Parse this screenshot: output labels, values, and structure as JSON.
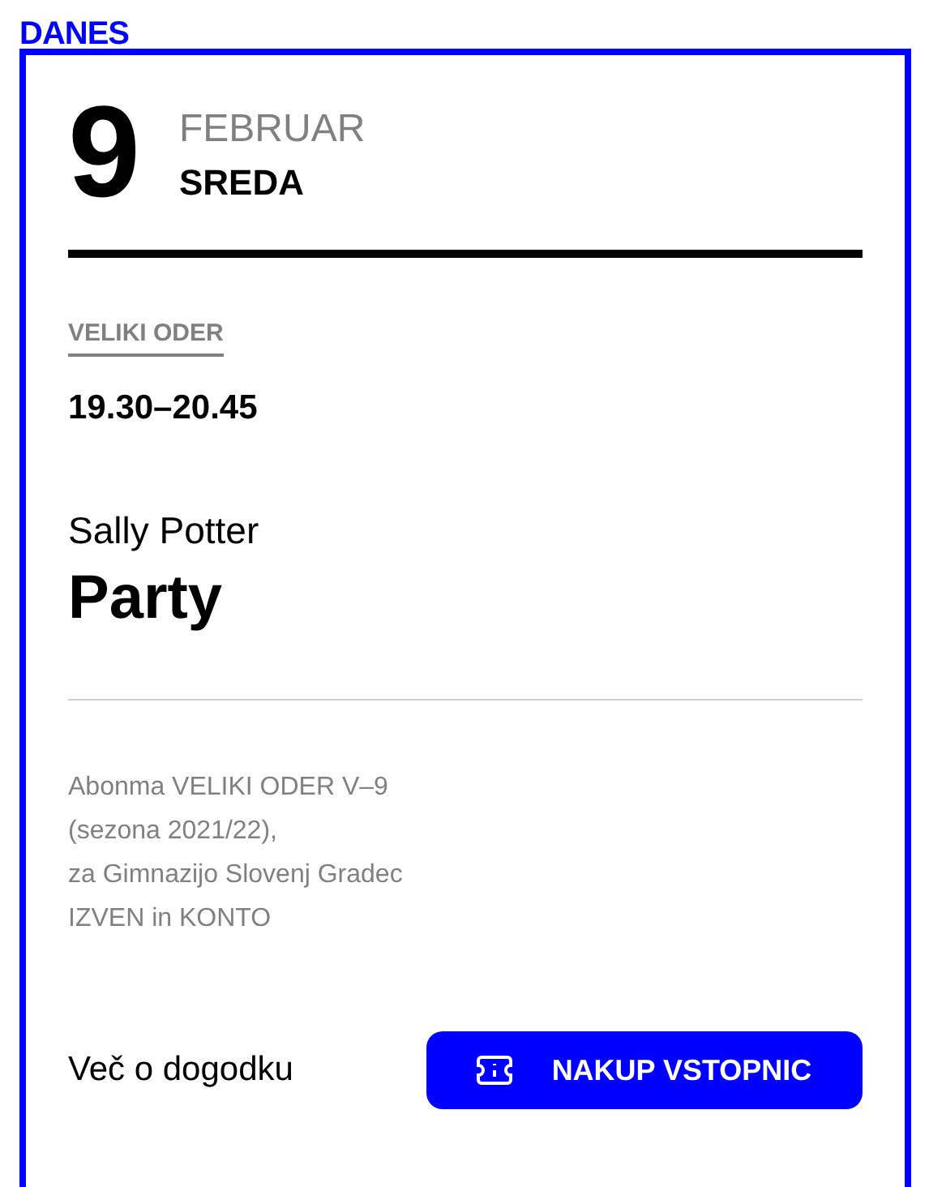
{
  "heading": "DANES",
  "date": {
    "day": "9",
    "month": "FEBRUAR",
    "weekday": "SREDA"
  },
  "event": {
    "venue": "VELIKI ODER",
    "time": "19.30–20.45",
    "author": "Sally Potter",
    "title": "Party",
    "description": [
      "Abonma VELIKI ODER V–9",
      "(sezona 2021/22),",
      "za Gimnazijo Slovenj Gradec",
      "IZVEN in KONTO"
    ]
  },
  "actions": {
    "more_link": "Več o dogodku",
    "buy_button": "NAKUP VSTOPNIC"
  }
}
